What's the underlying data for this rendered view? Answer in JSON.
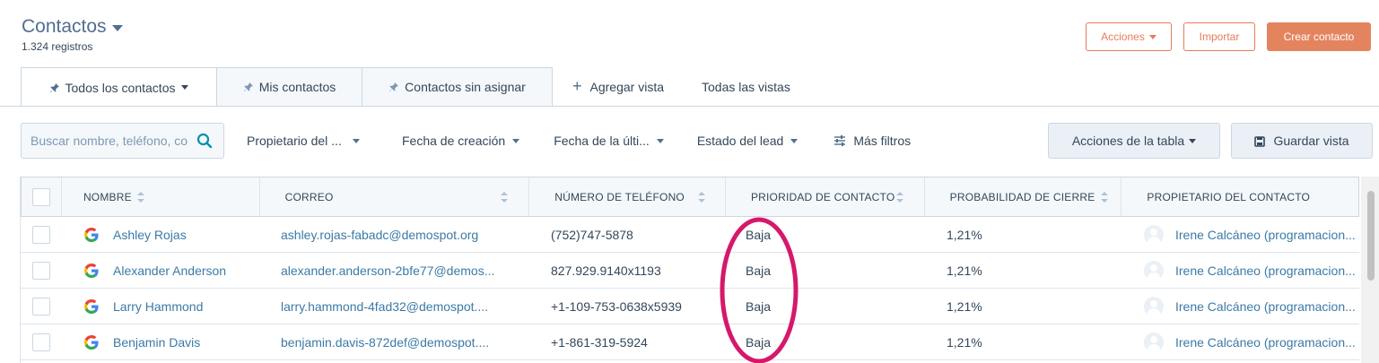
{
  "header": {
    "title": "Contactos",
    "record_count": "1.324 registros",
    "actions_label": "Acciones",
    "import_label": "Importar",
    "create_label": "Crear contacto"
  },
  "tabs": [
    {
      "label": "Todos los contactos"
    },
    {
      "label": "Mis contactos"
    },
    {
      "label": "Contactos sin asignar"
    }
  ],
  "add_view_label": "Agregar vista",
  "all_views_label": "Todas las vistas",
  "search": {
    "placeholder": "Buscar nombre, teléfono, correo"
  },
  "filters": {
    "owner": "Propietario del ...",
    "created": "Fecha de creación",
    "last": "Fecha de la últi...",
    "lead_status": "Estado del lead",
    "more": "Más filtros"
  },
  "table_actions_label": "Acciones de la tabla",
  "save_view_label": "Guardar vista",
  "columns": {
    "name": "NOMBRE",
    "email": "CORREO",
    "phone": "NÚMERO DE TELÉFONO",
    "priority": "PRIORIDAD DE CONTACTO",
    "probability": "PROBABILIDAD DE CIERRE",
    "owner": "PROPIETARIO DEL CONTACTO"
  },
  "rows": [
    {
      "name": "Ashley Rojas",
      "email": "ashley.rojas-fabadc@demospot.org",
      "phone": "(752)747-5878",
      "priority": "Baja",
      "probability": "1,21%",
      "owner": "Irene Calcáneo (programacion..."
    },
    {
      "name": "Alexander Anderson",
      "email": "alexander.anderson-2bfe77@demos...",
      "phone": "827.929.9140x1193",
      "priority": "Baja",
      "probability": "1,21%",
      "owner": "Irene Calcáneo (programacion..."
    },
    {
      "name": "Larry Hammond",
      "email": "larry.hammond-4fad32@demospot....",
      "phone": "+1-109-753-0638x5939",
      "priority": "Baja",
      "probability": "1,21%",
      "owner": "Irene Calcáneo (programacion..."
    },
    {
      "name": "Benjamin Davis",
      "email": "benjamin.davis-872def@demospot....",
      "phone": "+1-861-319-5924",
      "priority": "Baja",
      "probability": "1,21%",
      "owner": "Irene Calcáneo (programacion..."
    }
  ],
  "colors": {
    "accent": "#e4845f",
    "link": "#3b7aa6",
    "annotation": "#d6186b"
  }
}
